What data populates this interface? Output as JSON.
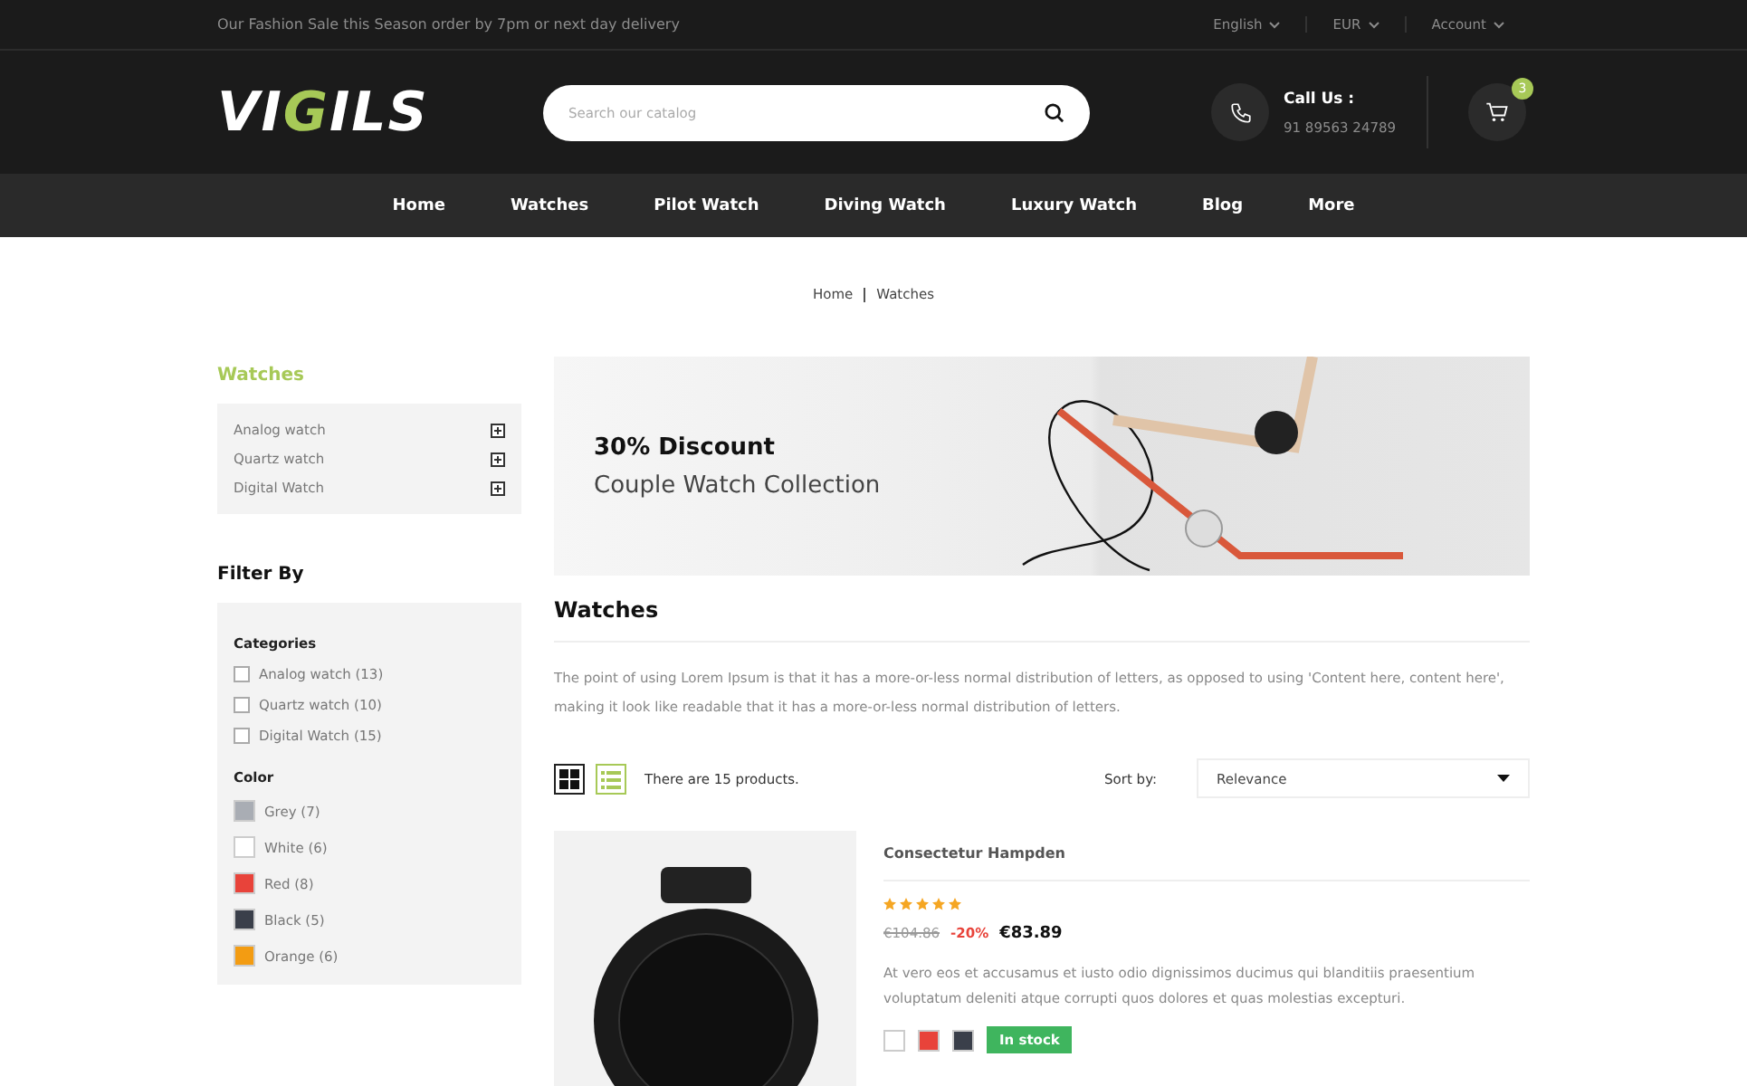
{
  "top_bar": {
    "promo": "Our Fashion Sale this Season order by 7pm or next day delivery",
    "menus": [
      "English",
      "EUR",
      "Account"
    ]
  },
  "header": {
    "logo": {
      "part1": "VI",
      "accent": "G",
      "part2": "ILS"
    },
    "search": {
      "placeholder": "Search our catalog"
    },
    "call": {
      "label": "Call Us :",
      "phone": "91 89563 24789"
    },
    "cart_count": "3"
  },
  "nav": [
    "Home",
    "Watches",
    "Pilot Watch",
    "Diving Watch",
    "Luxury Watch",
    "Blog",
    "More"
  ],
  "breadcrumb": [
    "Home",
    "Watches"
  ],
  "sidebar": {
    "title": "Watches",
    "categories": [
      "Analog watch",
      "Quartz watch",
      "Digital Watch"
    ],
    "filter_title": "Filter By",
    "categories_title": "Categories",
    "category_filters": [
      {
        "label": "Analog watch (13)",
        "checked": false
      },
      {
        "label": "Quartz watch (10)",
        "checked": false
      },
      {
        "label": "Digital Watch (15)",
        "checked": false
      }
    ],
    "color_title": "Color",
    "colors": [
      {
        "label": "Grey (7)",
        "color": "#a9adb4"
      },
      {
        "label": "White (6)",
        "color": "#ffffff"
      },
      {
        "label": "Red (8)",
        "color": "#e8433a"
      },
      {
        "label": "Black (5)",
        "color": "#3a3f4a"
      },
      {
        "label": "Orange (6)",
        "color": "#f39c12"
      }
    ]
  },
  "banner": {
    "title": "30% Discount",
    "subtitle": "Couple Watch Collection"
  },
  "category": {
    "title": "Watches",
    "description": "The point of using Lorem Ipsum is that it has a more-or-less normal distribution of letters, as opposed to using 'Content here, content here', making it look like readable that it has a more-or-less normal distribution of letters."
  },
  "toolbar": {
    "views": [
      {
        "kind": "grid",
        "selected": true
      },
      {
        "kind": "list",
        "selected": false
      }
    ],
    "count": "There are 15 products.",
    "sort_label": "Sort by:",
    "sort_value": "Relevance"
  },
  "product": {
    "name": "Consectetur Hampden",
    "stars": 5,
    "old_price": "€104.86",
    "discount": "-20%",
    "price": "€83.89",
    "description": "At vero eos et accusamus et iusto odio dignissimos ducimus qui blanditiis praesentium voluptatum deleniti atque corrupti quos dolores et quas molestias excepturi.",
    "colors": [
      {
        "color": "#ffffff"
      },
      {
        "color": "#e8433a"
      },
      {
        "color": "#3a3f4a"
      }
    ],
    "stock": "In stock"
  }
}
